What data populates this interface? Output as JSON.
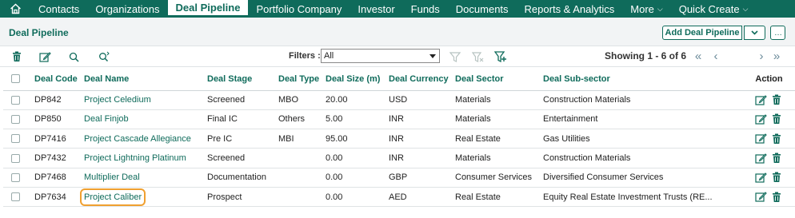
{
  "nav": {
    "items": [
      {
        "label": "Contacts"
      },
      {
        "label": "Organizations"
      },
      {
        "label": "Deal Pipeline",
        "active": true
      },
      {
        "label": "Portfolio Company"
      },
      {
        "label": "Investor"
      },
      {
        "label": "Funds"
      },
      {
        "label": "Documents"
      },
      {
        "label": "Reports & Analytics"
      },
      {
        "label": "More",
        "dropdown": true
      },
      {
        "label": "Quick Create",
        "dropdown": true
      }
    ]
  },
  "header": {
    "title": "Deal Pipeline",
    "add_button": "Add Deal Pipeline",
    "more_button": "…"
  },
  "toolbar": {
    "filters_label": "Filters :",
    "filters_value": "All",
    "showing": "Showing 1 - 6 of 6"
  },
  "table": {
    "columns": [
      "Deal Code",
      "Deal Name",
      "Deal Stage",
      "Deal Type",
      "Deal Size (m)",
      "Deal Currency",
      "Deal Sector",
      "Deal Sub-sector",
      "Action"
    ],
    "rows": [
      {
        "code": "DP842",
        "name": "Project Celedium",
        "stage": "Screened",
        "type": "MBO",
        "size": "20.00",
        "currency": "USD",
        "sector": "Materials",
        "subsector": "Construction Materials"
      },
      {
        "code": "DP850",
        "name": "Deal Finjob",
        "stage": "Final IC",
        "type": "Others",
        "size": "5.00",
        "currency": "INR",
        "sector": "Materials",
        "subsector": "Entertainment"
      },
      {
        "code": "DP7416",
        "name": "Project Cascade Allegiance",
        "stage": "Pre IC",
        "type": "MBI",
        "size": "95.00",
        "currency": "INR",
        "sector": "Real Estate",
        "subsector": "Gas Utilities"
      },
      {
        "code": "DP7432",
        "name": "Project Lightning Platinum",
        "stage": "Screened",
        "type": "",
        "size": "0.00",
        "currency": "INR",
        "sector": "Materials",
        "subsector": "Construction Materials"
      },
      {
        "code": "DP7468",
        "name": "Multiplier Deal",
        "stage": "Documentation",
        "type": "",
        "size": "0.00",
        "currency": "GBP",
        "sector": "Consumer Services",
        "subsector": "Diversified Consumer Services"
      },
      {
        "code": "DP7634",
        "name": "Project Caliber",
        "stage": "Prospect",
        "type": "",
        "size": "0.00",
        "currency": "AED",
        "sector": "Real Estate",
        "subsector": "Equity Real Estate Investment Trusts (RE...",
        "highlighted": true
      }
    ]
  },
  "colors": {
    "brand": "#0f6b5b",
    "highlight": "#f0a030"
  }
}
